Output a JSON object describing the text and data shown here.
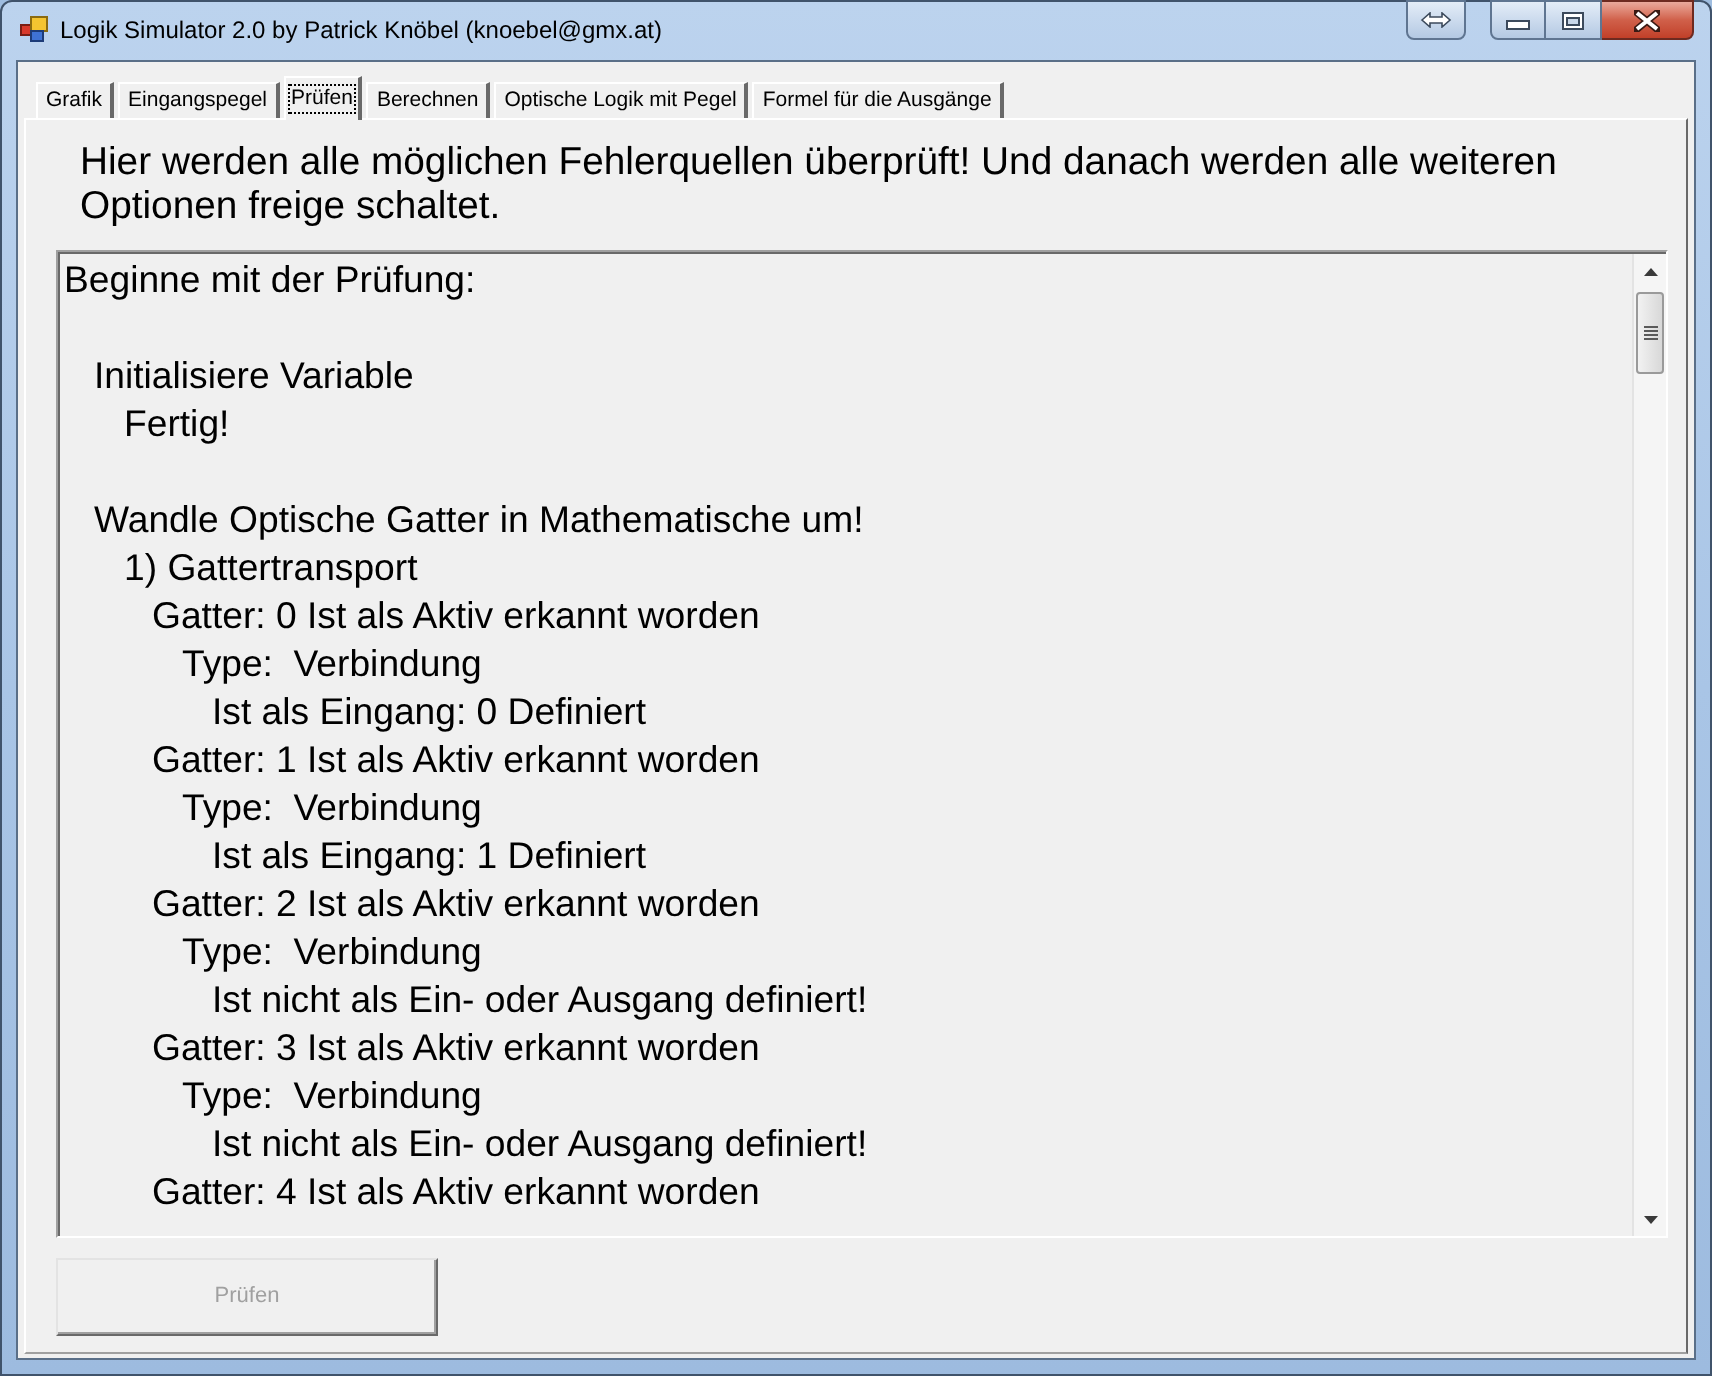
{
  "window": {
    "title": "Logik Simulator 2.0 by Patrick Knöbel (knoebel@gmx.at)"
  },
  "tabs": [
    {
      "label": "Grafik",
      "selected": false
    },
    {
      "label": "Eingangspegel",
      "selected": false
    },
    {
      "label": "Prüfen",
      "selected": true
    },
    {
      "label": "Berechnen",
      "selected": false
    },
    {
      "label": "Optische Logik mit Pegel",
      "selected": false
    },
    {
      "label": "Formel für die Ausgänge",
      "selected": false
    }
  ],
  "description": "Hier werden alle möglichen Fehlerquellen überprüft! Und danach werden alle weiteren Optionen freige schaltet.",
  "log": [
    {
      "text": "Beginne mit der Prüfung:",
      "children": [
        {
          "text": "Initialisiere Variable",
          "children": [
            {
              "text": "Fertig!"
            }
          ]
        },
        {
          "text": "Wandle Optische Gatter in Mathematische um!",
          "children": [
            {
              "text": "1) Gattertransport",
              "children": [
                {
                  "text": "Gatter: 0 Ist als Aktiv erkannt worden",
                  "children": [
                    {
                      "text": "Type:  Verbindung",
                      "children": [
                        {
                          "text": "Ist als Eingang: 0 Definiert"
                        }
                      ]
                    }
                  ]
                },
                {
                  "text": "Gatter: 1 Ist als Aktiv erkannt worden",
                  "children": [
                    {
                      "text": "Type:  Verbindung",
                      "children": [
                        {
                          "text": "Ist als Eingang: 1 Definiert"
                        }
                      ]
                    }
                  ]
                },
                {
                  "text": "Gatter: 2 Ist als Aktiv erkannt worden",
                  "children": [
                    {
                      "text": "Type:  Verbindung",
                      "children": [
                        {
                          "text": "Ist nicht als Ein- oder Ausgang definiert!"
                        }
                      ]
                    }
                  ]
                },
                {
                  "text": "Gatter: 3 Ist als Aktiv erkannt worden",
                  "children": [
                    {
                      "text": "Type:  Verbindung",
                      "children": [
                        {
                          "text": "Ist nicht als Ein- oder Ausgang definiert!"
                        }
                      ]
                    }
                  ]
                },
                {
                  "text": "Gatter: 4 Ist als Aktiv erkannt worden"
                }
              ]
            }
          ]
        }
      ]
    }
  ],
  "button": {
    "label": "Prüfen",
    "disabled": true
  }
}
